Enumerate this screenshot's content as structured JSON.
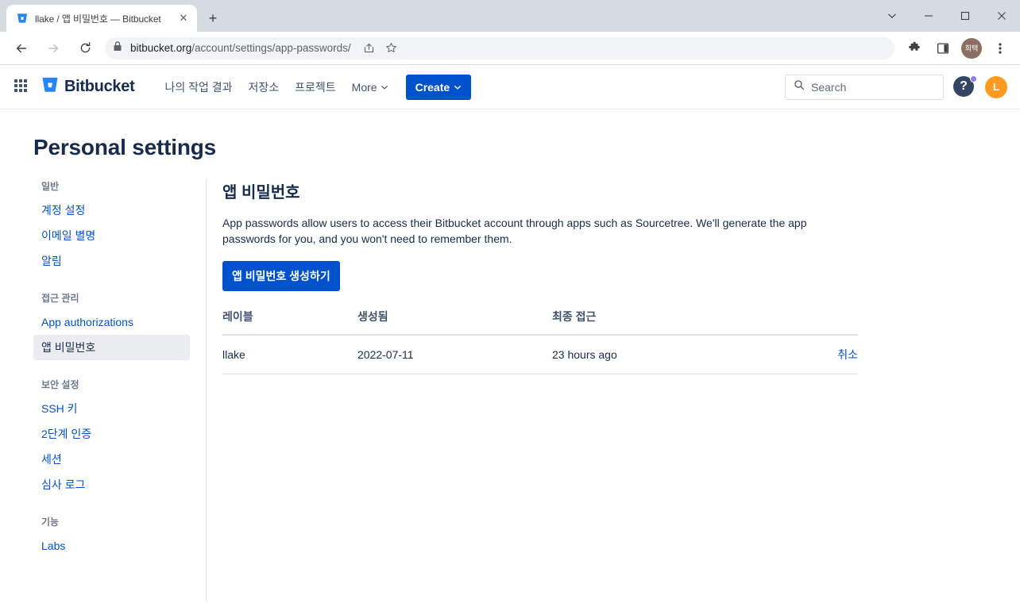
{
  "browser": {
    "tab": {
      "title": "llake / 앱 비밀번호 — Bitbucket",
      "favicon": "bitbucket-favicon",
      "close_label": "✕"
    },
    "new_tab_label": "+",
    "window_controls": {
      "collapse": "chevron-down-icon",
      "minimize": "minimize-icon",
      "maximize": "maximize-icon",
      "close": "close-icon"
    },
    "toolbar": {
      "back": "back-arrow-icon",
      "forward": "forward-arrow-icon",
      "reload": "reload-icon",
      "lock": "lock-icon",
      "url_domain": "bitbucket.org",
      "url_path": "/account/settings/app-passwords/",
      "share": "share-icon",
      "bookmark": "star-icon",
      "extensions": "puzzle-piece-icon",
      "side_panel": "side-panel-icon",
      "profile_initials": "희택",
      "menu": "three-dot-menu-icon"
    }
  },
  "nav": {
    "app_switcher": "grid-icon",
    "logo_text": "Bitbucket",
    "items": [
      {
        "label": "나의 작업 결과",
        "has_chevron": false
      },
      {
        "label": "저장소",
        "has_chevron": false
      },
      {
        "label": "프로젝트",
        "has_chevron": false
      },
      {
        "label": "More",
        "has_chevron": true
      }
    ],
    "create_label": "Create",
    "search_placeholder": "Search",
    "help_label": "?",
    "avatar_initial": "L"
  },
  "page": {
    "title": "Personal settings"
  },
  "sidebar": {
    "groups": [
      {
        "label": "일반",
        "items": [
          {
            "label": "계정 설정",
            "active": false
          },
          {
            "label": "이메일 별명",
            "active": false
          },
          {
            "label": "알림",
            "active": false
          }
        ]
      },
      {
        "label": "접근 관리",
        "items": [
          {
            "label": "App authorizations",
            "active": false
          },
          {
            "label": "앱 비밀번호",
            "active": true
          }
        ]
      },
      {
        "label": "보안 설정",
        "items": [
          {
            "label": "SSH 키",
            "active": false
          },
          {
            "label": "2단계 인증",
            "active": false
          },
          {
            "label": "세션",
            "active": false
          },
          {
            "label": "심사 로그",
            "active": false
          }
        ]
      },
      {
        "label": "기능",
        "items": [
          {
            "label": "Labs",
            "active": false
          }
        ]
      }
    ]
  },
  "content": {
    "section_title": "앱 비밀번호",
    "description": "App passwords allow users to access their Bitbucket account through apps such as Sourcetree. We'll generate the app passwords for you, and you won't need to remember them.",
    "generate_button": "앱 비밀번호 생성하기",
    "table": {
      "headers": [
        "레이블",
        "생성됨",
        "최종 접근",
        ""
      ],
      "rows": [
        {
          "label": "llake",
          "created": "2022-07-11",
          "last_accessed": "23 hours ago",
          "action": "취소"
        }
      ]
    }
  },
  "colors": {
    "brand_blue": "#0052CC",
    "link_blue": "#0052CC",
    "text_dark": "#172B4D",
    "text_muted": "#6B778C",
    "active_bg": "#EBECF0",
    "avatar_orange": "#FF991F",
    "help_navy": "#344563",
    "help_badge_purple": "#8F7EE7",
    "chrome_tabstrip": "#D6DAE1"
  }
}
